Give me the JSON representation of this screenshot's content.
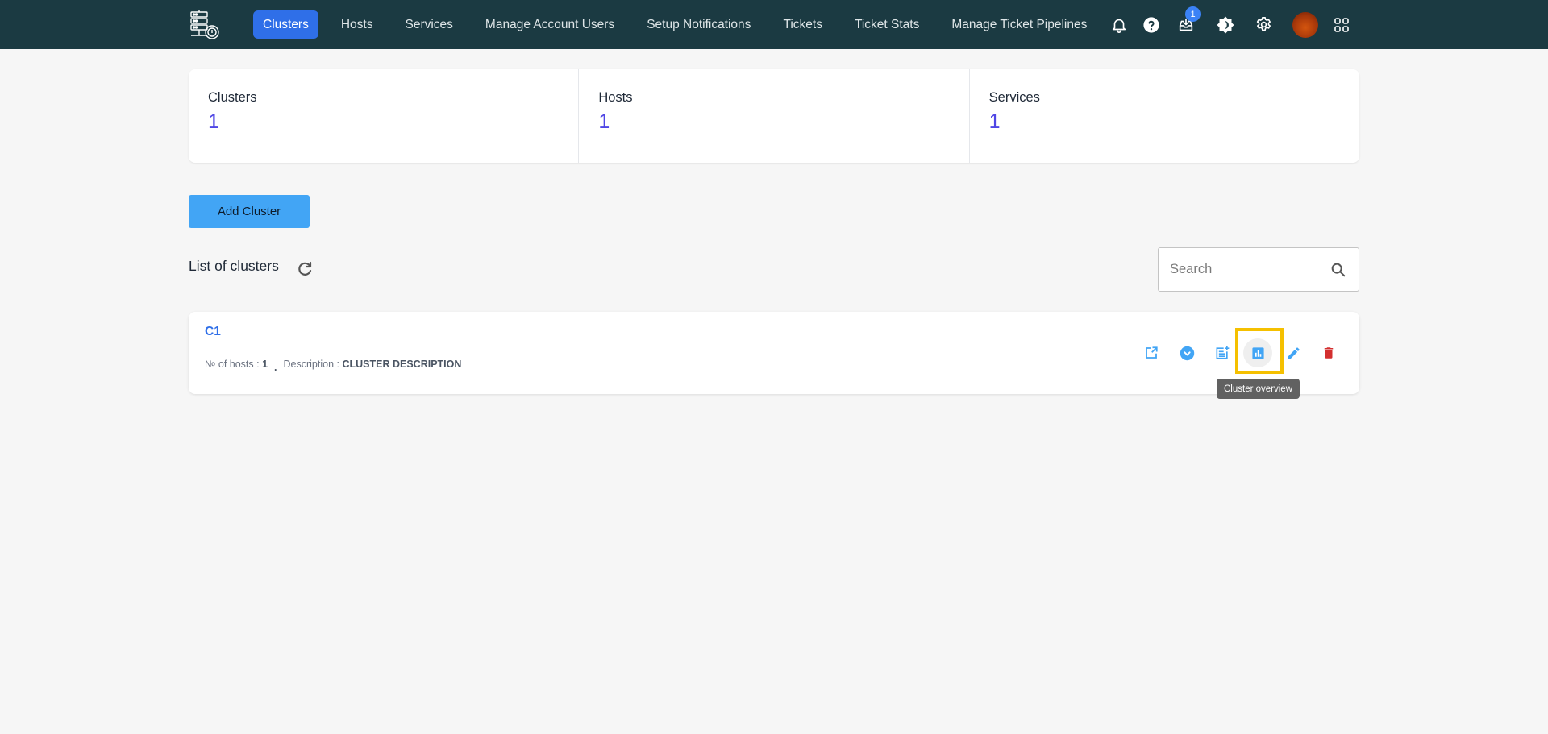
{
  "navbar": {
    "logo": "server-monitor-logo",
    "links": [
      {
        "label": "Clusters",
        "active": true
      },
      {
        "label": "Hosts",
        "active": false
      },
      {
        "label": "Services",
        "active": false
      },
      {
        "label": "Manage Account Users",
        "active": false
      },
      {
        "label": "Setup Notifications",
        "active": false
      },
      {
        "label": "Tickets",
        "active": false
      },
      {
        "label": "Ticket Stats",
        "active": false
      },
      {
        "label": "Manage Ticket Pipelines",
        "active": false
      }
    ],
    "icons": [
      "bell-icon",
      "help-icon",
      "inbox-icon",
      "theme-toggle-icon",
      "settings-icon",
      "avatar",
      "apps-grid-icon"
    ],
    "inbox_badge": "1"
  },
  "stats": [
    {
      "label": "Clusters",
      "value": "1"
    },
    {
      "label": "Hosts",
      "value": "1"
    },
    {
      "label": "Services",
      "value": "1"
    }
  ],
  "add_cluster_label": "Add Cluster",
  "list": {
    "title": "List of clusters",
    "search_placeholder": "Search",
    "search_value": ""
  },
  "clusters": [
    {
      "name": "C1",
      "hosts_label": "№ of hosts : ",
      "hosts_count": "1",
      "separator": ".",
      "description_label": "Description : ",
      "description": "CLUSTER DESCRIPTION",
      "actions": [
        "open-external",
        "expand",
        "add-note",
        "cluster-overview",
        "edit",
        "delete"
      ]
    }
  ],
  "tooltip": "Cluster overview",
  "colors": {
    "navbar_bg": "#1b3a42",
    "active_tab": "#2f6fe8",
    "stat_value": "#4f46e5",
    "add_button": "#42a5f5",
    "action_blue": "#42a5f5",
    "delete_red": "#d32f2f",
    "highlight": "#f5c000"
  }
}
